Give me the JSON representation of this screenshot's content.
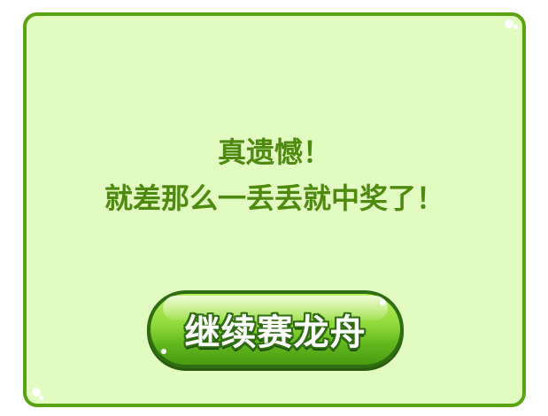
{
  "dialog": {
    "message_line1": "真遗憾！",
    "message_line2": "就差那么一丢丢就中奖了！",
    "continue_button_label": "继续赛龙舟"
  },
  "colors": {
    "panel_background": "#e2fbc0",
    "panel_border": "#5aa312",
    "message_text": "#4e8a10",
    "button_green": "#8fd83a",
    "button_outline": "#2e6d10"
  }
}
